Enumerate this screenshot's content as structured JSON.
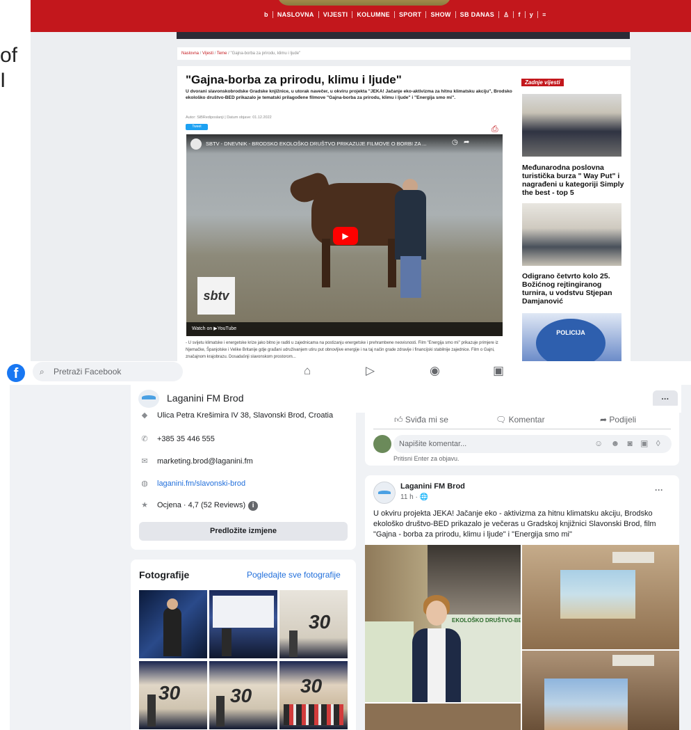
{
  "stray": {
    "line1": "of",
    "line2": "I"
  },
  "news": {
    "nav_items": [
      "NASLOVNA",
      "VIJESTI",
      "KOLUMNE",
      "SPORT",
      "SHOW",
      "SB DANAS"
    ],
    "nav_logo": "b",
    "nav_social": [
      "f",
      "y",
      "≡"
    ],
    "breadcrumb": [
      "Naslovna",
      "Vijesti",
      "Teme",
      "\"Gajna-borba za prirodu, klimu i ljude\""
    ],
    "article_title": "\"Gajna-borba za prirodu, klimu i ljude\"",
    "article_lead": "U dvorani slavonskobrodske Gradske knjižnice, u utorak navečer, u okviru projekta \"JEKA! Jačanje eko-aktivizma za hitnu klimatsku akciju\", Brodsko ekološko društvo-BED prikazalo je tematski prilagođene filmove \"Gajna-borba za prirodu, klimu i ljude\" i \"Energija smo mi\".",
    "article_meta": "Autor: SiBRediposlanji | Datum objave: 01.12.2022",
    "tweet_label": "Tweet",
    "video_title": "SBTV - DNEVNIK - BRODSKO EKOLOŠKO DRUŠTVO PRIKAZUJE FILMOVE O BORBI ZA ...",
    "video_logo": "sbtv",
    "video_watch": "Watch on ▶YouTube",
    "article_body": "- U svijetu klimatske i energetske krize jako bitno je raditi u zajednicama na postizanju energetske i prehrambene neovisnosti. Film \"Energija smo mi\" prikazuje primjere iz Njemačke, Španjolske i Velike Britanije gdje građani udruživanjem utiru put obnovljive energije i na taj način grade zdravije i financijski stabilnije zajednice. Film o Gajni, značajnom krajobrazu. Dosadašnji slavonskom prostorom...",
    "latest_label": "Zadnje vijesti",
    "latest": [
      {
        "caption": "Međunarodna poslovna turistička burza \" Way Put\" i nagrađeni u kategoriji Simply the best - top 5"
      },
      {
        "caption": "Odigrano četvrto kolo 25. Božićnog rejtingiranog turnira, u vodstvu Stjepan Damjanović"
      },
      {
        "caption": "POLICIJA"
      }
    ]
  },
  "facebook": {
    "search_placeholder": "Pretraži Facebook",
    "page_name": "Laganini FM Brod",
    "more_label": "···",
    "about": {
      "address": "Ulica Petra Krešimira IV 38, Slavonski Brod, Croatia",
      "phone": "+385 35 446 555",
      "email": "marketing.brod@laganini.fm",
      "website": "laganini.fm/slavonski-brod",
      "rating": "Ocjena · 4,7 (52 Reviews)",
      "suggest_label": "Predložite izmjene"
    },
    "photos": {
      "title": "Fotografije",
      "see_all": "Pogledajte sve fotografije"
    },
    "actions": {
      "like": "Sviđa mi se",
      "comment": "Komentar",
      "share": "Podijeli",
      "comment_placeholder": "Napišite komentar...",
      "enter_hint": "Pritisni Enter za objavu."
    },
    "post": {
      "author": "Laganini FM Brod",
      "time": "11 h · 🌐",
      "more": "···",
      "text": "U okviru projekta JEKA! Jačanje eko - aktivizma za hitnu klimatsku akciju, Brodsko ekološko društvo-BED prikazalo je večeras u Gradskoj knjižnici Slavonski Brod, film \"Gajna - borba za prirodu, klimu i ljude\" i \"Energija smo mi\"",
      "image_text": "EKOLOŠKO DRUŠTVO-BE"
    }
  }
}
